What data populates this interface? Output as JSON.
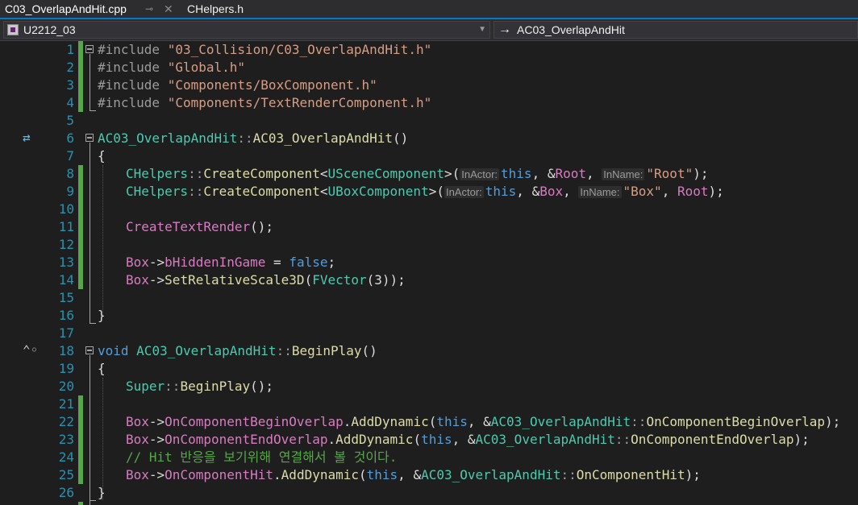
{
  "tabs": [
    {
      "label": "C03_OverlapAndHit.cpp",
      "active": true
    },
    {
      "label": "CHelpers.h",
      "active": false
    }
  ],
  "nav": {
    "project": "U2212_03",
    "scope": "AC03_OverlapAndHit"
  },
  "colors": {
    "background": "#1e1e1e",
    "line_number": "#2b91af",
    "change_marker": "#57a64a",
    "accent": "#007acc"
  },
  "line_numbers": [
    "1",
    "2",
    "3",
    "4",
    "5",
    "6",
    "7",
    "8",
    "9",
    "10",
    "11",
    "12",
    "13",
    "14",
    "15",
    "16",
    "17",
    "18",
    "19",
    "20",
    "21",
    "22",
    "23",
    "24",
    "25",
    "26"
  ],
  "code": {
    "l1": {
      "kw": "#include",
      "str": "\"03_Collision/C03_OverlapAndHit.h\""
    },
    "l2": {
      "kw": "#include",
      "str": "\"Global.h\""
    },
    "l3": {
      "kw": "#include",
      "str": "\"Components/BoxComponent.h\""
    },
    "l4": {
      "kw": "#include",
      "str": "\"Components/TextRenderComponent.h\""
    },
    "l6": {
      "cls": "AC03_OverlapAndHit",
      "sep": "::",
      "fn": "AC03_OverlapAndHit",
      "tail": "()"
    },
    "l7": {
      "t": "{"
    },
    "l8": {
      "a": "CHelpers",
      "b": "::",
      "c": "CreateComponent",
      "d": "<",
      "e": "USceneComponent",
      "f": ">(",
      "h1": "InActor:",
      "g": "this",
      "h": ", &",
      "i": "Root",
      "j": ", ",
      "h2": "InName:",
      "k": "\"Root\"",
      "l": ");"
    },
    "l9": {
      "a": "CHelpers",
      "b": "::",
      "c": "CreateComponent",
      "d": "<",
      "e": "UBoxComponent",
      "f": ">(",
      "h1": "InActor:",
      "g": "this",
      "h": ", &",
      "i": "Box",
      "j": ", ",
      "h2": "InName:",
      "k": "\"Box\"",
      "l": ", ",
      "m": "Root",
      "n": ");"
    },
    "l11": {
      "a": "CreateTextRender",
      "b": "();"
    },
    "l13": {
      "a": "Box",
      "b": "->",
      "c": "bHiddenInGame",
      "d": " = ",
      "e": "false",
      "f": ";"
    },
    "l14": {
      "a": "Box",
      "b": "->",
      "c": "SetRelativeScale3D",
      "d": "(",
      "e": "FVector",
      "f": "(3));"
    },
    "l16": {
      "t": "}"
    },
    "l18": {
      "kw": "void",
      "cls": "AC03_OverlapAndHit",
      "sep": "::",
      "fn": "BeginPlay",
      "tail": "()"
    },
    "l19": {
      "t": "{"
    },
    "l20": {
      "a": "Super",
      "b": "::",
      "c": "BeginPlay",
      "d": "();"
    },
    "l22": {
      "a": "Box",
      "b": "->",
      "c": "OnComponentBeginOverlap",
      "d": ".",
      "e": "AddDynamic",
      "f": "(",
      "g": "this",
      "h": ", &",
      "i": "AC03_OverlapAndHit",
      "j": "::",
      "k": "OnComponentBeginOverlap",
      "l": ");"
    },
    "l23": {
      "a": "Box",
      "b": "->",
      "c": "OnComponentEndOverlap",
      "d": ".",
      "e": "AddDynamic",
      "f": "(",
      "g": "this",
      "h": ", &",
      "i": "AC03_OverlapAndHit",
      "j": "::",
      "k": "OnComponentEndOverlap",
      "l": ");"
    },
    "l24": {
      "cm": "// Hit 반응을 보기위해 연결해서 볼 것이다."
    },
    "l25": {
      "a": "Box",
      "b": "->",
      "c": "OnComponentHit",
      "d": ".",
      "e": "AddDynamic",
      "f": "(",
      "g": "this",
      "h": ", &",
      "i": "AC03_OverlapAndHit",
      "j": "::",
      "k": "OnComponentHit",
      "l": ");"
    },
    "l26": {
      "t": "}"
    }
  }
}
